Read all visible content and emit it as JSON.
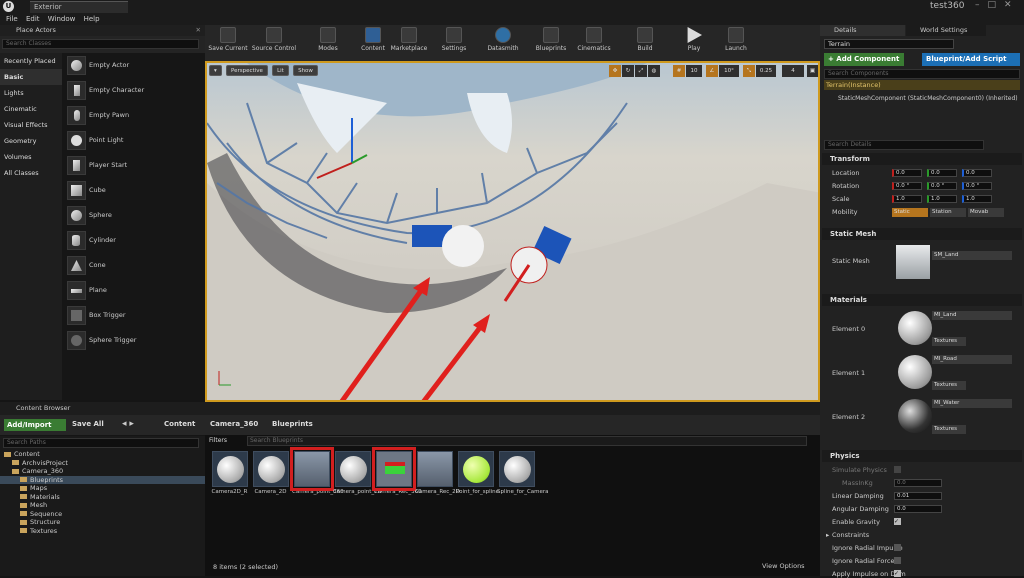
{
  "window": {
    "doc_tab": "Exterior",
    "project": "test360",
    "controls": "–□✕"
  },
  "menu": [
    "File",
    "Edit",
    "Window",
    "Help"
  ],
  "place_actors": {
    "title": "Place Actors",
    "search_placeholder": "Search Classes",
    "categories": [
      "Recently Placed",
      "Basic",
      "Lights",
      "Cinematic",
      "Visual Effects",
      "Geometry",
      "Volumes",
      "All Classes"
    ],
    "items": [
      "Empty Actor",
      "Empty Character",
      "Empty Pawn",
      "Point Light",
      "Player Start",
      "Cube",
      "Sphere",
      "Cylinder",
      "Cone",
      "Plane",
      "Box Trigger",
      "Sphere Trigger"
    ]
  },
  "toolbar": {
    "buttons": [
      "Save Current",
      "Source Control",
      "Modes",
      "Content",
      "Marketplace",
      "Settings",
      "Datasmith",
      "Blueprints",
      "Cinematics",
      "Build",
      "Play",
      "Launch"
    ]
  },
  "viewport": {
    "modes": [
      "Perspective",
      "Lit",
      "Show"
    ],
    "grid": "10",
    "angle": "10°",
    "scale": "0.25",
    "cam_speed": "4"
  },
  "content_browser": {
    "title": "Content Browser",
    "add_import": "Add/Import",
    "save_all": "Save All",
    "breadcrumb": [
      "Content",
      "Camera_360",
      "Blueprints"
    ],
    "search_paths": "Search Paths",
    "filters": "Filters",
    "search_blueprints": "Search Blueprints",
    "tree": [
      {
        "label": "Content",
        "level": 0
      },
      {
        "label": "ArchvisProject",
        "level": 1
      },
      {
        "label": "Camera_360",
        "level": 1
      },
      {
        "label": "Blueprints",
        "level": 2
      },
      {
        "label": "Maps",
        "level": 2
      },
      {
        "label": "Materials",
        "level": 2
      },
      {
        "label": "Mesh",
        "level": 2
      },
      {
        "label": "Sequence",
        "level": 2
      },
      {
        "label": "Structure",
        "level": 2
      },
      {
        "label": "Textures",
        "level": 2
      }
    ],
    "assets": [
      "Camera2D_R",
      "Camera_2D",
      "Camera_point_360",
      "Camera_point_2D",
      "Camera_Rec_360",
      "Camera_Rec_2D",
      "Point_for_spline",
      "Spline_for_Camera"
    ],
    "status": "8 items (2 selected)",
    "view_options": "View Options"
  },
  "details": {
    "tabs": [
      "Details",
      "World Settings"
    ],
    "actor_name": "Terrain",
    "add_component": "+ Add Component",
    "blueprint_script": "Blueprint/Add Script",
    "search_components": "Search Components",
    "instance": "Terrain(Instance)",
    "component": "StaticMeshComponent (StaticMeshComponent0) (Inherited)",
    "search_details": "Search Details",
    "transform": {
      "title": "Transform",
      "location_label": "Location",
      "rotation_label": "Rotation",
      "scale_label": "Scale",
      "mobility_label": "Mobility",
      "location": [
        "0.0",
        "0.0",
        "0.0"
      ],
      "rotation": [
        "0.0 °",
        "0.0 °",
        "0.0 °"
      ],
      "scale": [
        "1.0",
        "1.0",
        "1.0"
      ],
      "mobility": [
        "Static",
        "Station",
        "Movab"
      ]
    },
    "static_mesh": {
      "title": "Static Mesh",
      "label": "Static Mesh",
      "value": "SM_Land"
    },
    "materials": {
      "title": "Materials",
      "elements": [
        {
          "label": "Element 0",
          "value": "MI_Land"
        },
        {
          "label": "Element 1",
          "value": "MI_Road"
        },
        {
          "label": "Element 2",
          "value": "MI_Water"
        }
      ],
      "textures": "Textures"
    },
    "physics": {
      "title": "Physics",
      "simulate": "Simulate Physics",
      "mass": "MassInKg",
      "mass_value": "0.0",
      "linear": "Linear Damping",
      "linear_value": "0.01",
      "angular": "Angular Damping",
      "angular_value": "0.0",
      "gravity": "Enable Gravity",
      "constraints": "Constraints",
      "radial_impulse": "Ignore Radial Impulse",
      "radial_force": "Ignore Radial Force",
      "apply_impulse": "Apply Impulse on Dam"
    }
  },
  "colors": {
    "accent": "#cf9a1e",
    "arrow": "#e0201d",
    "green": "#3a7c33",
    "blue": "#1c6fb5"
  }
}
